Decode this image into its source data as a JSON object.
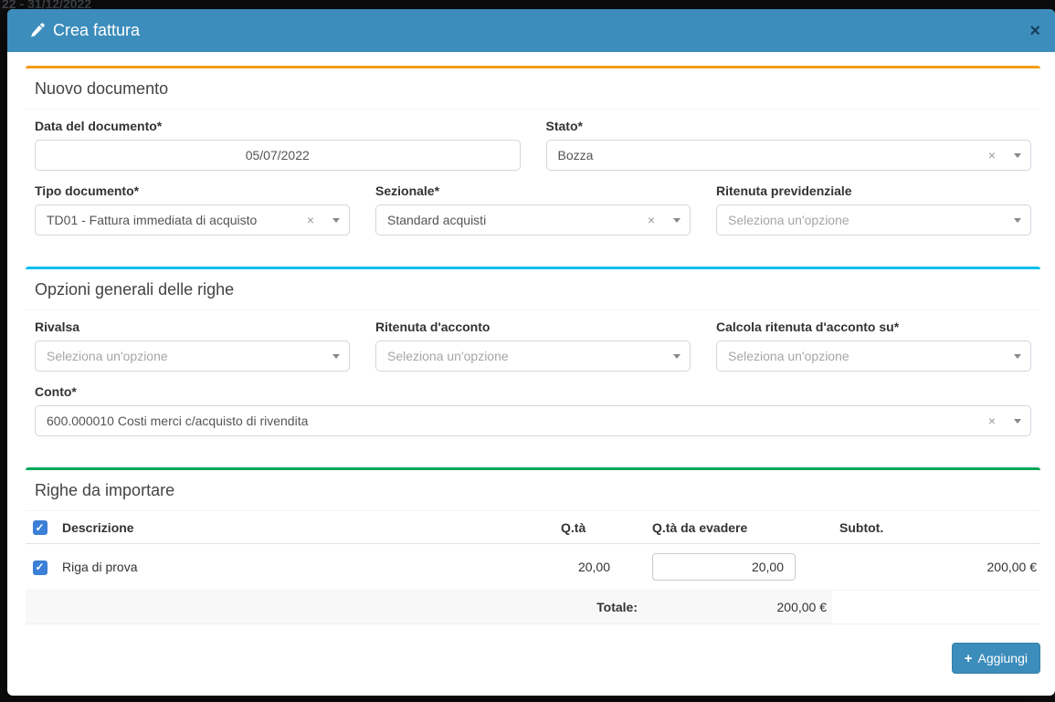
{
  "backdrop": {
    "page_fragment": "22 - 31/12/2022"
  },
  "icons": {
    "close": "×",
    "clear": "×",
    "plus": "+"
  },
  "modal": {
    "title": "Crea fattura"
  },
  "nuovo_documento": {
    "title": "Nuovo documento",
    "accent": "#f39c12",
    "data_documento_label": "Data del documento*",
    "data_documento_value": "05/07/2022",
    "stato_label": "Stato*",
    "stato_value": "Bozza",
    "tipo_documento_label": "Tipo documento*",
    "tipo_documento_value": "TD01 - Fattura immediata di acquisto",
    "sezionale_label": "Sezionale*",
    "sezionale_value": "Standard acquisti",
    "ritenuta_previdenziale_label": "Ritenuta previdenziale",
    "ritenuta_previdenziale_placeholder": "Seleziona un'opzione"
  },
  "opzioni_generali": {
    "title": "Opzioni generali delle righe",
    "accent": "#00c0ef",
    "rivalsa_label": "Rivalsa",
    "rivalsa_placeholder": "Seleziona un'opzione",
    "ritenuta_acconto_label": "Ritenuta d'acconto",
    "ritenuta_acconto_placeholder": "Seleziona un'opzione",
    "calcola_ritenuta_label": "Calcola ritenuta d'acconto su*",
    "calcola_ritenuta_placeholder": "Seleziona un'opzione",
    "conto_label": "Conto*",
    "conto_value": "600.000010 Costi merci c/acquisto di rivendita"
  },
  "righe": {
    "title": "Righe da importare",
    "accent": "#00a65a",
    "headers": {
      "descrizione": "Descrizione",
      "qta": "Q.tà",
      "qta_da_evadere": "Q.tà da evadere",
      "subtot": "Subtot."
    },
    "rows": [
      {
        "descrizione": "Riga di prova",
        "qta": "20,00",
        "qta_da_evadere": "20,00",
        "subtot": "200,00 €",
        "checked": true
      }
    ],
    "totale_label": "Totale:",
    "totale_value": "200,00 €"
  },
  "footer": {
    "aggiungi_label": "Aggiungi"
  }
}
